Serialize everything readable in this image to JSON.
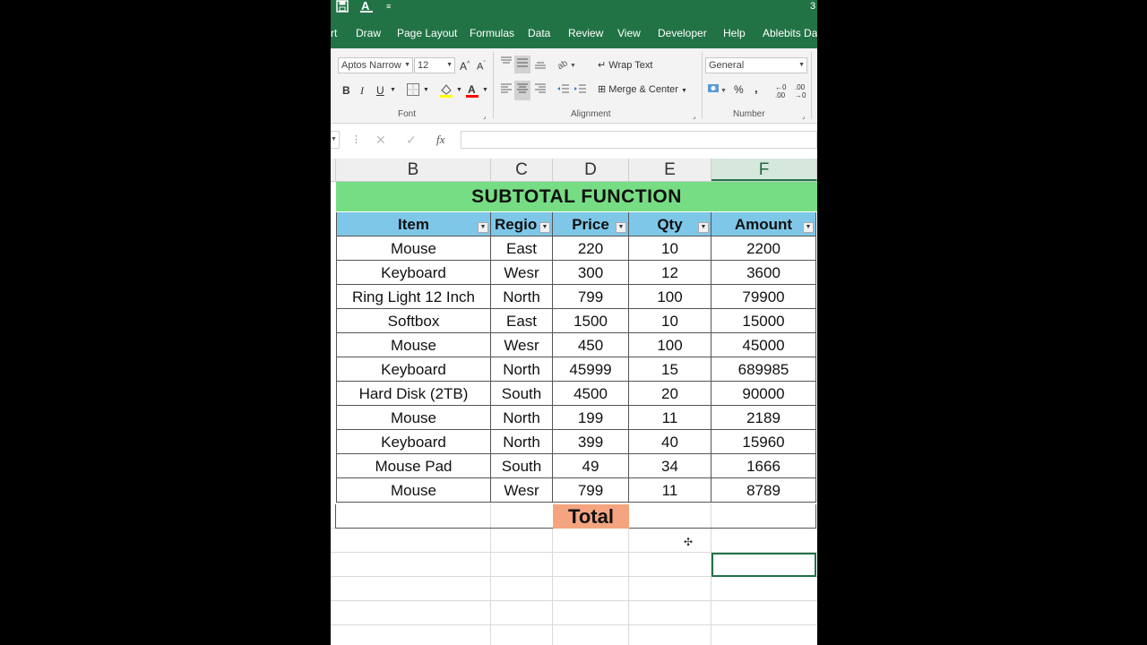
{
  "window": {
    "title_fragment": "3"
  },
  "tabs": [
    "rt",
    "Draw",
    "Page Layout",
    "Formulas",
    "Data",
    "Review",
    "View",
    "Developer",
    "Help",
    "Ablebits Dat"
  ],
  "ribbon": {
    "font_name": "Aptos Narrow",
    "font_size": "12",
    "bold": "B",
    "italic": "I",
    "underline": "U",
    "wrap_text": "Wrap Text",
    "merge_center": "Merge & Center",
    "number_format": "General",
    "percent": "%",
    "comma": ",",
    "group_font": "Font",
    "group_alignment": "Alignment",
    "group_number": "Number",
    "colors": {
      "highlight": "#ffff00",
      "font_color": "#ff0000"
    }
  },
  "formula_bar": {
    "fx": "fx",
    "value": ""
  },
  "columns": [
    "B",
    "C",
    "D",
    "E",
    "F"
  ],
  "sheet": {
    "title": "SUBTOTAL FUNCTION",
    "headers": [
      "Item",
      "Regio",
      "Price",
      "Qty",
      "Amount"
    ],
    "rows": [
      [
        "Mouse",
        "East",
        "220",
        "10",
        "2200"
      ],
      [
        "Keyboard",
        "Wesr",
        "300",
        "12",
        "3600"
      ],
      [
        "Ring Light 12 Inch",
        "North",
        "799",
        "100",
        "79900"
      ],
      [
        "Softbox",
        "East",
        "1500",
        "10",
        "15000"
      ],
      [
        "Mouse",
        "Wesr",
        "450",
        "100",
        "45000"
      ],
      [
        "Keyboard",
        "North",
        "45999",
        "15",
        "689985"
      ],
      [
        "Hard Disk (2TB)",
        "South",
        "4500",
        "20",
        "90000"
      ],
      [
        "Mouse",
        "North",
        "199",
        "11",
        "2189"
      ],
      [
        "Keyboard",
        "North",
        "399",
        "40",
        "15960"
      ],
      [
        "Mouse Pad",
        "South",
        "49",
        "34",
        "1666"
      ],
      [
        "Mouse",
        "Wesr",
        "799",
        "11",
        "8789"
      ]
    ],
    "total_label": "Total"
  }
}
